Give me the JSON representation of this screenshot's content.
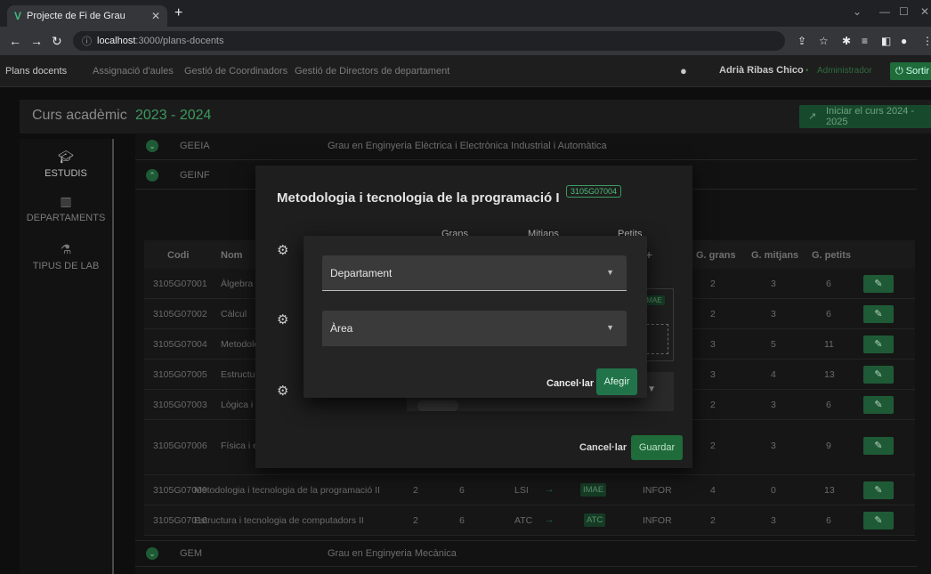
{
  "browser": {
    "tab_title": "Projecte de Fi de Grau",
    "url_host": "localhost",
    "url_rest": ":3000/plans-docents"
  },
  "nav": {
    "items": [
      "Plans docents",
      "Assignació d'aules",
      "Gestió de Coordinadors",
      "Gestió de Directors de departament"
    ],
    "user": "Adrià Ribas Chico",
    "role": "Administrador",
    "logout": "Sortir"
  },
  "curs": {
    "label": "Curs acadèmic",
    "year": "2023 - 2024",
    "iniciar": "Iniciar el curs 2024 - 2025"
  },
  "sidebar": {
    "items": [
      {
        "label": "ESTUDIS",
        "icon": "graduation-cap-icon"
      },
      {
        "label": "DEPARTAMENTS",
        "icon": "building-icon"
      },
      {
        "label": "TIPUS DE LAB",
        "icon": "flask-icon"
      }
    ]
  },
  "degrees": {
    "geeia": {
      "code": "GEEIA",
      "name": "Grau en Enginyeria Elèctrica i Electrònica Industrial i Automàtica"
    },
    "geinf": {
      "code": "GEINF"
    },
    "gem": {
      "code": "GEM",
      "name": "Grau en Enginyeria Mecànica"
    }
  },
  "table": {
    "headers": {
      "codi": "Codi",
      "nom": "Nom",
      "ggrans": "G. grans",
      "gmitjans": "G. mitjans",
      "gpetits": "G. petits"
    },
    "rows": [
      {
        "codi": "3105G07001",
        "nom": "Àlgebra",
        "ggrans": "2",
        "gmitjans": "3",
        "gpetits": "6"
      },
      {
        "codi": "3105G07002",
        "nom": "Càlcul",
        "ggrans": "2",
        "gmitjans": "3",
        "gpetits": "6"
      },
      {
        "codi": "3105G07004",
        "nom": "Metodolo",
        "ggrans": "3",
        "gmitjans": "5",
        "gpetits": "11"
      },
      {
        "codi": "3105G07005",
        "nom": "Estructur",
        "ggrans": "3",
        "gmitjans": "4",
        "gpetits": "13"
      },
      {
        "codi": "3105G07003",
        "nom": "Lògica i r",
        "ggrans": "2",
        "gmitjans": "3",
        "gpetits": "6"
      },
      {
        "codi": "3105G07006",
        "nom": "Física i e",
        "ggrans": "2",
        "gmitjans": "3",
        "gpetits": "9"
      },
      {
        "codi": "3105G07009",
        "nom": "Metodologia i tecnologia de la programació II",
        "c1": "2",
        "c2": "6",
        "dept": "LSI",
        "area": "IMAE",
        "grup": "INFOR",
        "ggrans": "4",
        "gmitjans": "0",
        "gpetits": "13"
      },
      {
        "codi": "3105G07016",
        "nom": "Estructura i tecnologia de computadors II",
        "c1": "2",
        "c2": "6",
        "dept": "ATC",
        "area": "ATC",
        "grup": "INFOR",
        "ggrans": "2",
        "gmitjans": "3",
        "gpetits": "6"
      }
    ]
  },
  "dialog1": {
    "title": "Metodologia i tecnologia de la programació I",
    "code": "3105G07004",
    "col_grans": "Grans",
    "col_mitjans": "Mitjans",
    "col_petits": "Petits",
    "badge": "IMAE",
    "cancel": "Cancel·lar",
    "save": "Guardar"
  },
  "dialog2": {
    "departament_label": "Departament",
    "area_label": "Àrea",
    "cancel": "Cancel·lar",
    "add": "Afegir"
  },
  "colors": {
    "accent": "#21744a",
    "vue": "#41b883"
  }
}
